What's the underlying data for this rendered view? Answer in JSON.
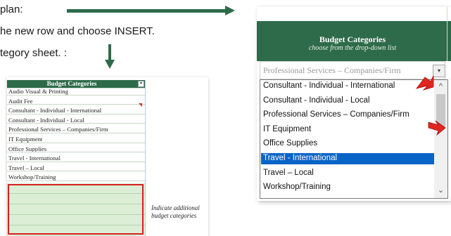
{
  "instructions": {
    "line1": "plan:",
    "line2": "he new row and choose INSERT.",
    "line3": "tegory sheet. :"
  },
  "left_sheet": {
    "header": "Budget Categories",
    "dropdown_glyph": "▾",
    "rows": [
      "Audio Visual & Printing",
      "Audit Fee",
      "Consultant - Individual - International",
      "Consultant - Individual - Local",
      "Professional Services – Companies/Firm",
      "IT Equipment",
      "Office Supplies",
      "Travel - International",
      "Travel – Local",
      "Workshop/Training"
    ],
    "note": "Indicate additional budget categories"
  },
  "right_panel": {
    "title": "Budget Categories",
    "subtitle": "choose from the drop-down list",
    "selected_value": "Professional Services – Companies/Firm",
    "dropdown_glyph": "▾",
    "options": [
      "Consultant - Individual - International",
      "Consultant - Individual - Local",
      "Professional Services – Companies/Firm",
      "IT Equipment",
      "Office Supplies",
      "Travel - International",
      "Travel – Local",
      "Workshop/Training"
    ],
    "highlighted_index": 5,
    "scroll_up_glyph": "^",
    "scroll_down_glyph": "⌄"
  },
  "colors": {
    "header_green": "#2e6b4a",
    "highlight_blue": "#0a64c8",
    "callout_red": "#d62020",
    "pointer_red": "#e0261f"
  }
}
